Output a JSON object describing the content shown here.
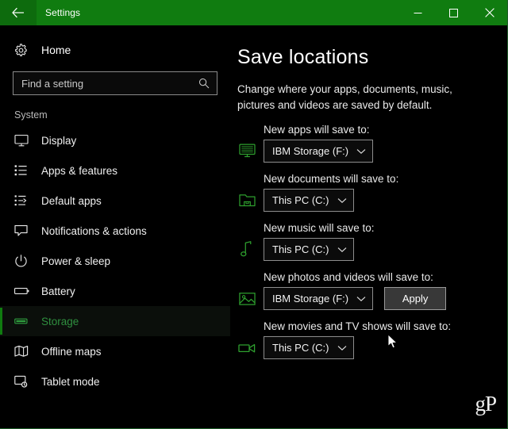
{
  "window": {
    "title": "Settings",
    "titlebar_color": "#107c10",
    "back_icon": "back-arrow-icon",
    "minimize_label": "Minimize",
    "maximize_label": "Maximize",
    "close_label": "Close"
  },
  "sidebar": {
    "home": {
      "label": "Home",
      "icon": "gear-icon"
    },
    "search": {
      "placeholder": "Find a setting",
      "value": "",
      "icon": "search-icon"
    },
    "group_title": "System",
    "accent_color": "#107c10",
    "items": [
      {
        "label": "Display",
        "icon": "monitor-icon",
        "selected": false
      },
      {
        "label": "Apps & features",
        "icon": "list-icon",
        "selected": false
      },
      {
        "label": "Default apps",
        "icon": "list-arrow-icon",
        "selected": false
      },
      {
        "label": "Notifications & actions",
        "icon": "notification-icon",
        "selected": false
      },
      {
        "label": "Power & sleep",
        "icon": "power-icon",
        "selected": false
      },
      {
        "label": "Battery",
        "icon": "battery-icon",
        "selected": false
      },
      {
        "label": "Storage",
        "icon": "storage-icon",
        "selected": true
      },
      {
        "label": "Offline maps",
        "icon": "map-icon",
        "selected": false
      },
      {
        "label": "Tablet mode",
        "icon": "tablet-icon",
        "selected": false
      }
    ]
  },
  "main": {
    "page_title": "Save locations",
    "description": "Change where your apps, documents, music, pictures and videos are saved by default.",
    "icon_color": "#2ea02e",
    "save_rows": [
      {
        "label": "New apps will save to:",
        "icon": "apps-monitor-icon",
        "value": "IBM Storage (F:)",
        "has_apply": false
      },
      {
        "label": "New documents will save to:",
        "icon": "folder-icon",
        "value": "This PC (C:)",
        "has_apply": false
      },
      {
        "label": "New music will save to:",
        "icon": "music-note-icon",
        "value": "This PC (C:)",
        "has_apply": false
      },
      {
        "label": "New photos and videos will save to:",
        "icon": "photo-icon",
        "value": "IBM Storage (F:)",
        "has_apply": true,
        "apply_label": "Apply"
      },
      {
        "label": "New movies and TV shows will save to:",
        "icon": "video-camera-icon",
        "value": "This PC (C:)",
        "has_apply": false
      }
    ]
  },
  "watermark": {
    "text": "gP"
  }
}
